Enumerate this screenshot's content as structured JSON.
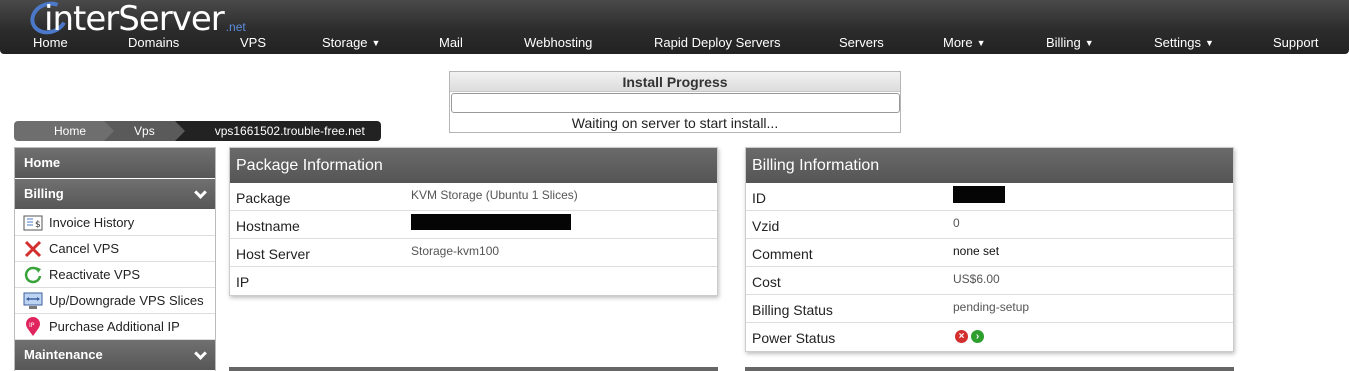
{
  "brand": {
    "logo_main": "interServer",
    "logo_suffix": ".net"
  },
  "nav": {
    "items": [
      {
        "label": "Home",
        "dropdown": false
      },
      {
        "label": "Domains",
        "dropdown": false
      },
      {
        "label": "VPS",
        "dropdown": false
      },
      {
        "label": "Storage",
        "dropdown": true
      },
      {
        "label": "Mail",
        "dropdown": false
      },
      {
        "label": "Webhosting",
        "dropdown": false
      },
      {
        "label": "Rapid Deploy Servers",
        "dropdown": false
      },
      {
        "label": "Servers",
        "dropdown": false
      },
      {
        "label": "More",
        "dropdown": true
      },
      {
        "label": "Billing",
        "dropdown": true
      },
      {
        "label": "Settings",
        "dropdown": true
      },
      {
        "label": "Support",
        "dropdown": false
      }
    ]
  },
  "install_progress": {
    "title": "Install Progress",
    "progress_fraction": 0,
    "status": "Waiting on server to start install..."
  },
  "breadcrumb": {
    "items": [
      "Home",
      "Vps",
      "vps1661502.trouble-free.net"
    ]
  },
  "sidebar": {
    "home": "Home",
    "billing_section": "Billing",
    "billing_items": [
      {
        "label": "Invoice History",
        "icon": "invoice-icon"
      },
      {
        "label": "Cancel VPS",
        "icon": "cancel-x-icon"
      },
      {
        "label": "Reactivate VPS",
        "icon": "reactivate-icon"
      },
      {
        "label": "Up/Downgrade VPS Slices",
        "icon": "upgrade-icon"
      },
      {
        "label": "Purchase Additional IP",
        "icon": "ip-pin-icon"
      }
    ],
    "maintenance_section": "Maintenance"
  },
  "package": {
    "title": "Package Information",
    "rows": [
      {
        "label": "Package",
        "value": "KVM Storage (Ubuntu 1 Slices)"
      },
      {
        "label": "Hostname",
        "value": ""
      },
      {
        "label": "Host Server",
        "value": "Storage-kvm100"
      },
      {
        "label": "IP",
        "value": ""
      }
    ]
  },
  "billing": {
    "title": "Billing Information",
    "rows": [
      {
        "label": "ID",
        "value": ""
      },
      {
        "label": "Vzid",
        "value": "0"
      },
      {
        "label": "Comment",
        "value": "none set"
      },
      {
        "label": "Cost",
        "value": "US$6.00"
      },
      {
        "label": "Billing Status",
        "value": "pending-setup"
      },
      {
        "label": "Power Status",
        "value": ""
      }
    ]
  },
  "colors": {
    "accent_blue": "#4b78c8",
    "panel_header": "#5e5e5e",
    "power_off": "#d32f2f",
    "power_on": "#2e9e2e"
  }
}
